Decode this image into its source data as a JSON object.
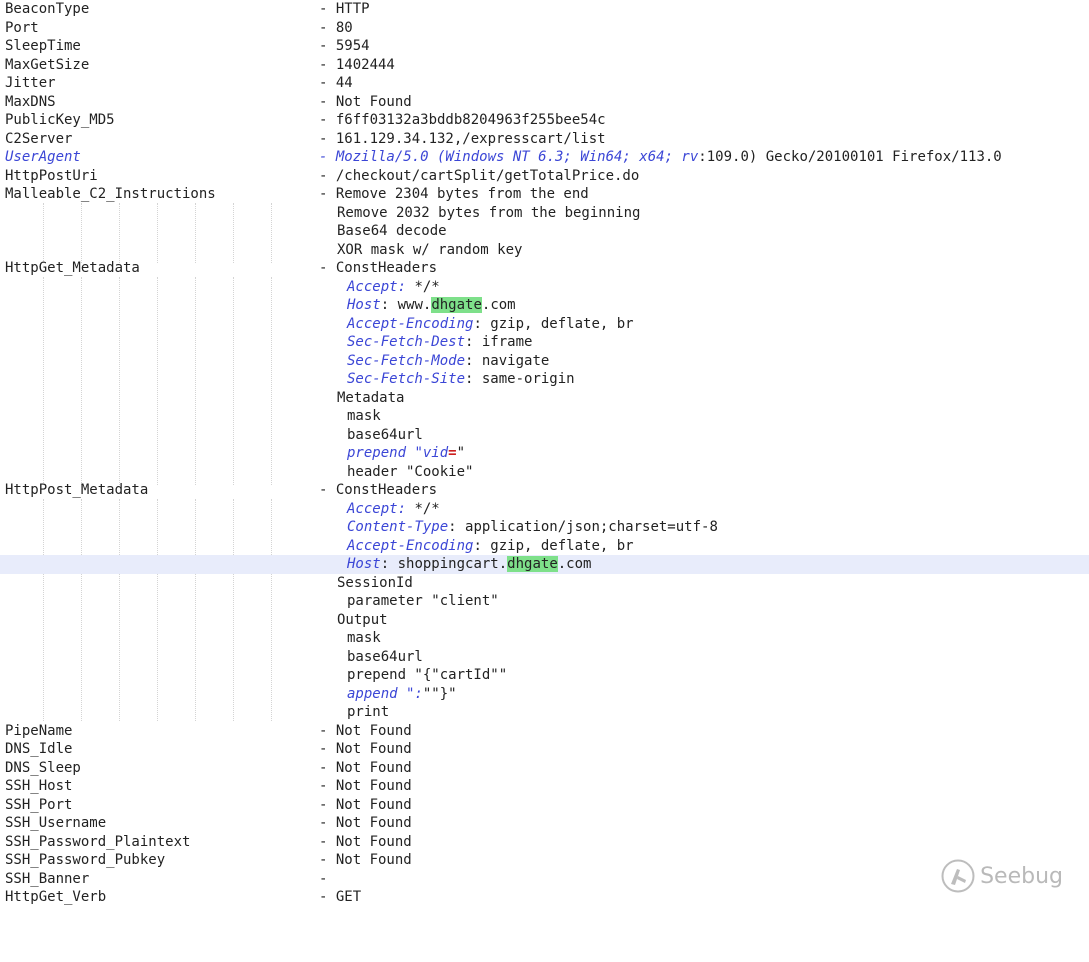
{
  "config": {
    "beacon_type": {
      "key": "BeaconType",
      "value": "- HTTP"
    },
    "port": {
      "key": "Port",
      "value": "- 80"
    },
    "sleep_time": {
      "key": "SleepTime",
      "value": "- 5954"
    },
    "max_get_size": {
      "key": "MaxGetSize",
      "value": "- 1402444"
    },
    "jitter": {
      "key": "Jitter",
      "value": "- 44"
    },
    "max_dns": {
      "key": "MaxDNS",
      "value": "- Not Found"
    },
    "public_key_md5": {
      "key": "PublicKey_MD5",
      "value": "- f6ff03132a3bddb8204963f255bee54c"
    },
    "c2_server": {
      "key": "C2Server",
      "value": "- 161.129.34.132,/expresscart/list"
    },
    "user_agent": {
      "key": "UserAgent",
      "value_italic": "- Mozilla/5.0 (Windows NT 6.3; Win64; x64; rv",
      "value_rest": ":109.0) Gecko/20100101 Firefox/113.0"
    },
    "http_post_uri": {
      "key": "HttpPostUri",
      "value": "- /checkout/cartSplit/getTotalPrice.do"
    },
    "malleable": {
      "key": "Malleable_C2_Instructions",
      "first": "- Remove 2304 bytes from the end",
      "rest": [
        "Remove 2032 bytes from the beginning",
        "Base64 decode",
        "XOR mask w/ random key"
      ]
    },
    "http_get_metadata": {
      "key": "HttpGet_Metadata",
      "const_headers_label": "- ConstHeaders",
      "headers": {
        "accept": {
          "name": "Accept",
          "sep": ":",
          "value": " */*"
        },
        "host": {
          "name": "Host",
          "sep": ":",
          "pre": " www.",
          "mark": "dhgate",
          "post": ".com"
        },
        "accept_encoding": {
          "name": "Accept-Encoding",
          "sep": ":",
          "value": " gzip, deflate, br"
        },
        "sec_fetch_dest": {
          "name": "Sec-Fetch-Dest",
          "sep": ":",
          "value": " iframe"
        },
        "sec_fetch_mode": {
          "name": "Sec-Fetch-Mode",
          "sep": ":",
          "value": " navigate"
        },
        "sec_fetch_site": {
          "name": "Sec-Fetch-Site",
          "sep": ":",
          "value": " same-origin"
        }
      },
      "metadata_label": "Metadata",
      "mask": "mask",
      "base64url": "base64url",
      "prepend": {
        "word": "prepend",
        "q1": " \"vid",
        "eq": "=",
        "q2": "\""
      },
      "header": "header \"Cookie\""
    },
    "http_post_metadata": {
      "key": "HttpPost_Metadata",
      "const_headers_label": "- ConstHeaders",
      "headers": {
        "accept": {
          "name": "Accept",
          "sep": ":",
          "value": " */*"
        },
        "content_type": {
          "name": "Content-Type",
          "sep": ":",
          "value": " application/json;charset=utf-8"
        },
        "accept_encoding": {
          "name": "Accept-Encoding",
          "sep": ":",
          "value": " gzip, deflate, br"
        },
        "host": {
          "name": "Host",
          "sep": ":",
          "pre": " shoppingcart.",
          "mark": "dhgate",
          "post": ".com"
        }
      },
      "session_id_label": "SessionId",
      "parameter": "parameter \"client\"",
      "output_label": "Output",
      "mask": "mask",
      "base64url": "base64url",
      "prepend": "prepend \"{\"cartId\"\"",
      "append": {
        "word": "append",
        "rest_italic": " \":",
        "rest_plain": "\"\"}\""
      },
      "print": "print"
    },
    "pipe_name": {
      "key": "PipeName",
      "value": "- Not Found"
    },
    "dns_idle": {
      "key": "DNS_Idle",
      "value": "- Not Found"
    },
    "dns_sleep": {
      "key": "DNS_Sleep",
      "value": "- Not Found"
    },
    "ssh_host": {
      "key": "SSH_Host",
      "value": "- Not Found"
    },
    "ssh_port": {
      "key": "SSH_Port",
      "value": "- Not Found"
    },
    "ssh_username": {
      "key": "SSH_Username",
      "value": "- Not Found"
    },
    "ssh_password_plaintext": {
      "key": "SSH_Password_Plaintext",
      "value": "- Not Found"
    },
    "ssh_password_pubkey": {
      "key": "SSH_Password_Pubkey",
      "value": "- Not Found"
    },
    "ssh_banner": {
      "key": "SSH_Banner",
      "value": "-"
    },
    "http_get_verb": {
      "key": "HttpGet_Verb",
      "value": "- GET"
    }
  },
  "watermark": {
    "text": "Seebug",
    "icon": "seebug-logo-icon"
  },
  "colors": {
    "keyword": "#3b46d6",
    "highlight_green": "#7ee08a",
    "highlight_line": "#e8ecfb",
    "text": "#222222"
  }
}
